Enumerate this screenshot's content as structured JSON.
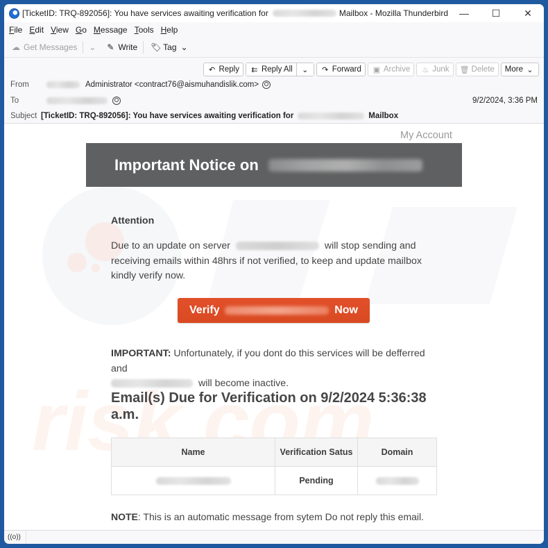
{
  "window": {
    "title_prefix": "[TicketID: TRQ-892056]: You have services awaiting verification for",
    "title_suffix": "Mailbox - Mozilla Thunderbird",
    "minimize_glyph": "—",
    "maximize_glyph": "☐",
    "close_glyph": "✕"
  },
  "menu": [
    {
      "label": "File",
      "accel": "F",
      "rest": "ile"
    },
    {
      "label": "Edit",
      "accel": "E",
      "rest": "dit"
    },
    {
      "label": "View",
      "accel": "V",
      "rest": "iew"
    },
    {
      "label": "Go",
      "accel": "G",
      "rest": "o"
    },
    {
      "label": "Message",
      "accel": "M",
      "rest": "essage"
    },
    {
      "label": "Tools",
      "accel": "T",
      "rest": "ools"
    },
    {
      "label": "Help",
      "accel": "H",
      "rest": "elp"
    }
  ],
  "toolbar": {
    "get_messages": "Get Messages",
    "write": "Write",
    "tag": "Tag"
  },
  "actions": {
    "reply": "Reply",
    "reply_all": "Reply All",
    "forward": "Forward",
    "archive": "Archive",
    "junk": "Junk",
    "delete": "Delete",
    "more": "More"
  },
  "header": {
    "from_label": "From",
    "from_value": "Administrator <contract76@aismuhandislik.com>",
    "to_label": "To",
    "subject_label": "Subject",
    "subject_prefix": "[TicketID: TRQ-892056]: You have services awaiting verification for",
    "subject_suffix": "Mailbox",
    "date": "9/2/2024, 3:36 PM"
  },
  "body": {
    "my_account": "My Account",
    "banner_title": "Important Notice on",
    "attention": "Attention",
    "para_part1": "Due to an  update on server",
    "para_part2": "will  stop sending and receiving emails within 48hrs  if not verified, to keep and update mailbox kindly verify now.",
    "verify_left": "Verify",
    "verify_right": "Now",
    "important_label": "IMPORTANT:",
    "important_text": "Unfortunately, if you dont do this services will be defferred and",
    "important_tail": "will become inactive.",
    "due_title": "Email(s) Due for Verification on 9/2/2024 5:36:38 a.m.",
    "table": {
      "headers": [
        "Name",
        "Verification Satus",
        "Domain"
      ],
      "rows": [
        {
          "status": "Pending"
        }
      ]
    },
    "note_label": "NOTE",
    "note_text": ": This is an automatic message from sytem Do not reply this email."
  },
  "statusbar": {
    "icon": "((o))"
  },
  "colors": {
    "banner_bg": "#5e6061",
    "verify_button": "#dd4c25",
    "desktop": "#1f5aa0"
  }
}
